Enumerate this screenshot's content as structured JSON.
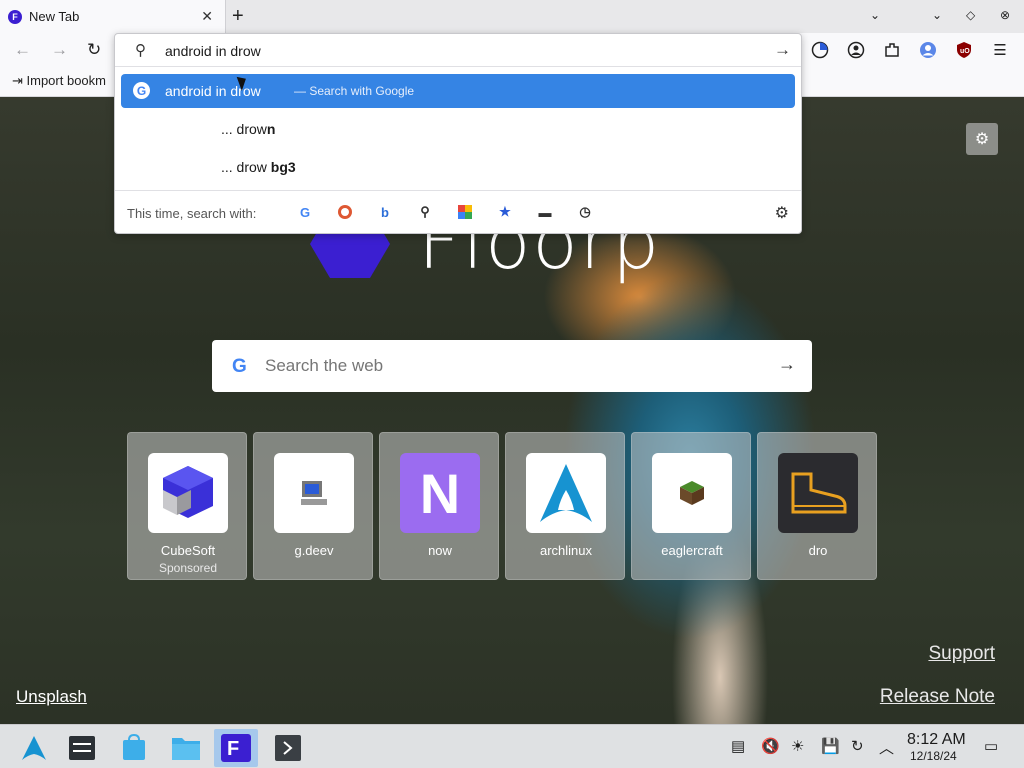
{
  "tab": {
    "title": "New Tab",
    "close_glyph": "✕"
  },
  "tabbar": {
    "new_tab_glyph": "+",
    "chevron": "⌄",
    "minimize": "⌄",
    "diamond": "◇",
    "close": "⊗"
  },
  "bookmarks": {
    "import_label": "⇥ Import bookm"
  },
  "urlbar": {
    "value": "android in drow",
    "suggestions": [
      {
        "text": "android in drow",
        "hint": "— Search with Google"
      },
      {
        "prefix": "... drow",
        "suffix": "n"
      },
      {
        "prefix": "... drow ",
        "suffix": "bg3"
      }
    ],
    "search_with_label": "This time, search with:",
    "engines": [
      "google-icon",
      "duckduckgo-icon",
      "bing-icon",
      "search-icon",
      "photos-icon",
      "bookmarks-icon",
      "tabs-icon",
      "history-icon"
    ]
  },
  "page": {
    "brand": "Floorp",
    "search_placeholder": "Search the web",
    "tiles": [
      {
        "label": "CubeSoft",
        "sub": "Sponsored",
        "icon": "cube-icon"
      },
      {
        "label": "g.deev",
        "sub": "",
        "icon": "computer-icon"
      },
      {
        "label": "now",
        "sub": "",
        "icon": "N"
      },
      {
        "label": "archlinux",
        "sub": "",
        "icon": "arch-icon"
      },
      {
        "label": "eaglercraft",
        "sub": "",
        "icon": "grass-block-icon"
      },
      {
        "label": "dro",
        "sub": "",
        "icon": "boot-icon"
      }
    ],
    "unsplash": "Unsplash",
    "support": "Support",
    "release_note": "Release Note"
  },
  "taskbar": {
    "time": "8:12 AM",
    "date": "12/18/24"
  },
  "colors": {
    "accent": "#3584e4",
    "brand": "#3b1fd1"
  }
}
